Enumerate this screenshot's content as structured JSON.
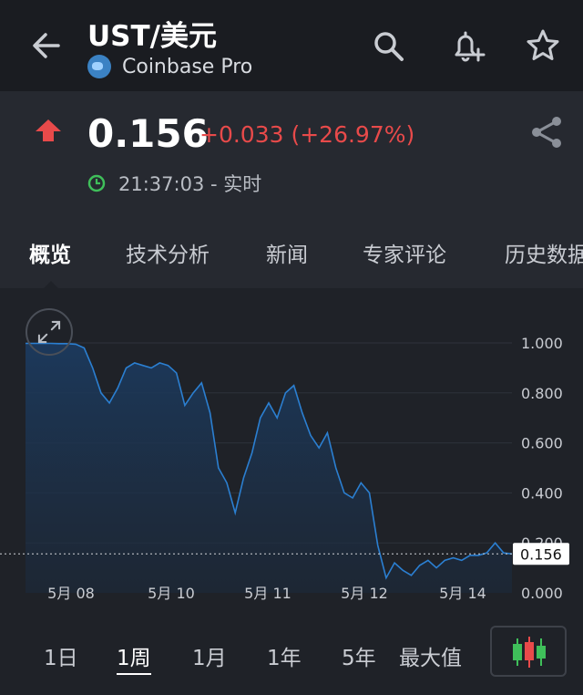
{
  "header": {
    "title": "UST/美元",
    "exchange": "Coinbase Pro",
    "icons": [
      "back-arrow-icon",
      "search-icon",
      "bell-add-icon",
      "star-icon"
    ]
  },
  "quote": {
    "price": "0.156",
    "change": "+0.033 (+26.97%)",
    "time": "21:37:03 - 实时",
    "colors": {
      "up": "#e84a4a",
      "realtime": "#3fbf5a"
    }
  },
  "tabs": [
    {
      "label": "概览",
      "active": true
    },
    {
      "label": "技术分析",
      "active": false
    },
    {
      "label": "新闻",
      "active": false
    },
    {
      "label": "专家评论",
      "active": false
    },
    {
      "label": "历史数据",
      "active": false
    }
  ],
  "chart_data": {
    "type": "area",
    "x_tick_labels": [
      "5月 08",
      "5月 10",
      "5月 11",
      "5月 12",
      "5月 14"
    ],
    "y_tick_labels": [
      "1.000",
      "0.800",
      "0.600",
      "0.400",
      "0.200",
      "0.000"
    ],
    "ylim": [
      0,
      1.0
    ],
    "last_value_label": "0.156",
    "line_color": "#2b7fd1",
    "series": [
      {
        "values": [
          0.998,
          0.998,
          0.998,
          0.998,
          0.997,
          0.997,
          0.995,
          0.98,
          0.9,
          0.8,
          0.76,
          0.82,
          0.9,
          0.92,
          0.91,
          0.9,
          0.92,
          0.91,
          0.88,
          0.75,
          0.8,
          0.84,
          0.72,
          0.5,
          0.44,
          0.32,
          0.46,
          0.56,
          0.7,
          0.76,
          0.7,
          0.8,
          0.83,
          0.72,
          0.63,
          0.58,
          0.64,
          0.5,
          0.4,
          0.38,
          0.44,
          0.4,
          0.19,
          0.06,
          0.12,
          0.09,
          0.07,
          0.11,
          0.13,
          0.1,
          0.13,
          0.14,
          0.13,
          0.15,
          0.15,
          0.16,
          0.2,
          0.16,
          0.156
        ]
      }
    ]
  },
  "ranges": [
    {
      "label": "1日",
      "active": false
    },
    {
      "label": "1周",
      "active": true
    },
    {
      "label": "1月",
      "active": false
    },
    {
      "label": "1年",
      "active": false
    },
    {
      "label": "5年",
      "active": false
    },
    {
      "label": "最大值",
      "active": false
    }
  ]
}
